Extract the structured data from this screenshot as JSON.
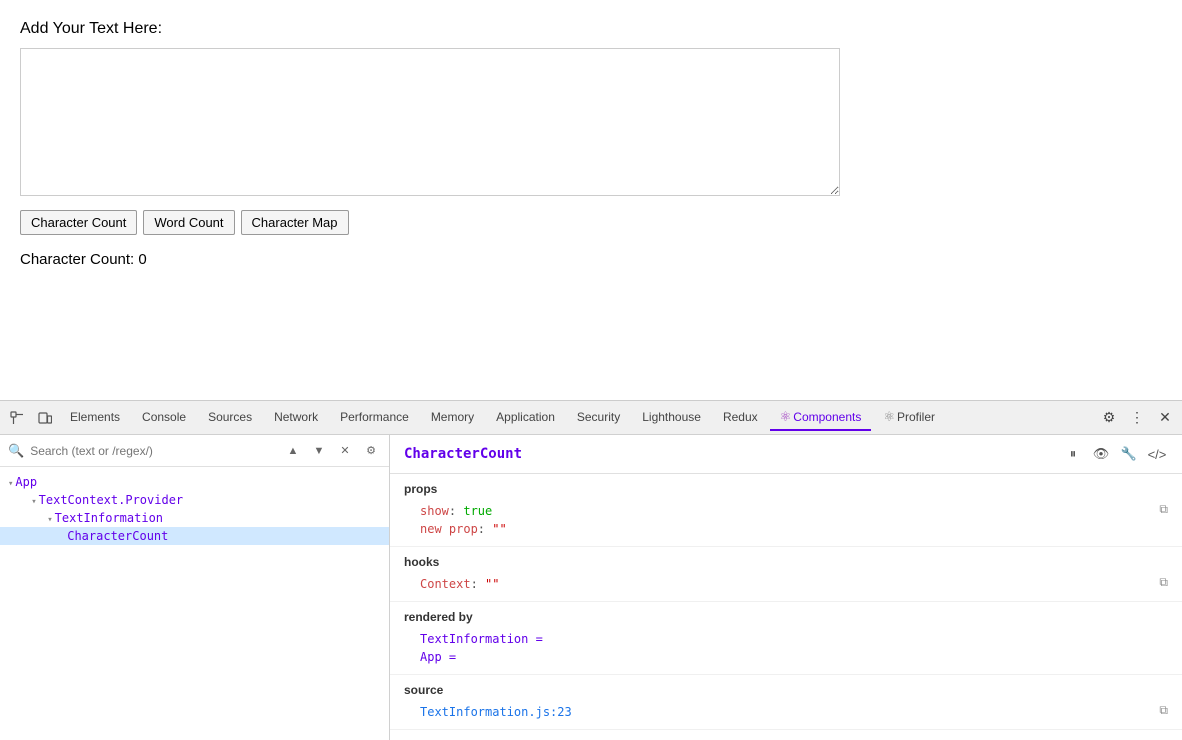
{
  "app": {
    "label": "Add Your Text Here:",
    "textarea_placeholder": "",
    "char_count_display": "Character Count: 0",
    "buttons": [
      {
        "id": "char-count-btn",
        "label": "Character Count"
      },
      {
        "id": "word-count-btn",
        "label": "Word Count"
      },
      {
        "id": "char-map-btn",
        "label": "Character Map"
      }
    ]
  },
  "devtools": {
    "tabs": [
      {
        "id": "elements",
        "label": "Elements",
        "active": false
      },
      {
        "id": "console",
        "label": "Console",
        "active": false
      },
      {
        "id": "sources",
        "label": "Sources",
        "active": false
      },
      {
        "id": "network",
        "label": "Network",
        "active": false
      },
      {
        "id": "performance",
        "label": "Performance",
        "active": false
      },
      {
        "id": "memory",
        "label": "Memory",
        "active": false
      },
      {
        "id": "application",
        "label": "Application",
        "active": false
      },
      {
        "id": "security",
        "label": "Security",
        "active": false
      },
      {
        "id": "lighthouse",
        "label": "Lighthouse",
        "active": false
      },
      {
        "id": "redux",
        "label": "Redux",
        "active": false
      },
      {
        "id": "components",
        "label": "Components",
        "active": true
      },
      {
        "id": "profiler",
        "label": "Profiler",
        "active": false
      }
    ],
    "search_placeholder": "Search (text or /regex/)",
    "component_tree": [
      {
        "indent": 0,
        "label": "▾ App",
        "type": "app",
        "selected": false
      },
      {
        "indent": 1,
        "label": "▾ TextContext.Provider",
        "type": "component",
        "selected": false
      },
      {
        "indent": 2,
        "label": "▾ TextInformation",
        "type": "component",
        "selected": false
      },
      {
        "indent": 3,
        "label": "CharacterCount",
        "type": "component",
        "selected": true
      }
    ],
    "selected_component": "CharacterCount",
    "props": {
      "title": "props",
      "rows": [
        {
          "key": "show",
          "colon": ":",
          "value": "true",
          "type": "bool"
        },
        {
          "key": "new prop",
          "colon": ":",
          "value": "\"\"",
          "type": "str"
        }
      ]
    },
    "hooks": {
      "title": "hooks",
      "rows": [
        {
          "key": "Context",
          "colon": ":",
          "value": "\"\"",
          "type": "str"
        }
      ]
    },
    "rendered_by": {
      "title": "rendered by",
      "items": [
        "TextInformation =",
        "App ="
      ]
    },
    "source": {
      "title": "source",
      "value": "TextInformation.js:23"
    }
  }
}
